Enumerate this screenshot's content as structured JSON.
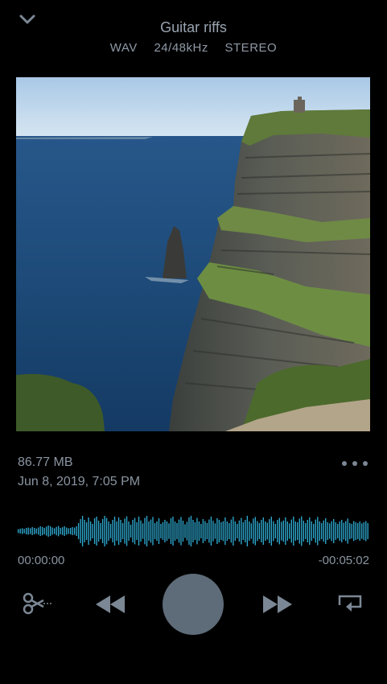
{
  "track": {
    "title": "Guitar riffs",
    "format": [
      "WAV",
      "24/48kHz",
      "STEREO"
    ]
  },
  "file": {
    "size": "86.77 MB",
    "date": "Jun 8, 2019, 7:05 PM"
  },
  "playback": {
    "elapsed": "00:00:00",
    "remaining": "-00:05:02"
  },
  "colors": {
    "background": "#000000",
    "text": "#8a95a1",
    "waveform": "#2ea8cf",
    "play_button": "#5e6b78"
  },
  "waveform_levels": [
    0.12,
    0.15,
    0.18,
    0.14,
    0.2,
    0.22,
    0.18,
    0.25,
    0.2,
    0.16,
    0.22,
    0.3,
    0.26,
    0.2,
    0.28,
    0.35,
    0.3,
    0.22,
    0.18,
    0.26,
    0.32,
    0.2,
    0.24,
    0.3,
    0.22,
    0.18,
    0.2,
    0.25,
    0.22,
    0.3,
    0.5,
    0.75,
    0.95,
    0.7,
    0.55,
    0.85,
    0.6,
    0.45,
    0.8,
    0.9,
    0.65,
    0.5,
    0.75,
    0.95,
    0.82,
    0.6,
    0.45,
    0.7,
    0.9,
    0.6,
    0.85,
    0.7,
    0.5,
    0.78,
    0.92,
    0.6,
    0.4,
    0.7,
    0.82,
    0.55,
    0.9,
    0.66,
    0.48,
    0.82,
    0.95,
    0.6,
    0.72,
    0.88,
    0.5,
    0.6,
    0.8,
    0.45,
    0.55,
    0.7,
    0.6,
    0.48,
    0.8,
    0.9,
    0.6,
    0.5,
    0.72,
    0.88,
    0.65,
    0.42,
    0.58,
    0.85,
    0.95,
    0.7,
    0.55,
    0.82,
    0.6,
    0.45,
    0.75,
    0.62,
    0.5,
    0.72,
    0.9,
    0.64,
    0.48,
    0.8,
    0.7,
    0.55,
    0.62,
    0.85,
    0.6,
    0.5,
    0.72,
    0.9,
    0.6,
    0.45,
    0.66,
    0.82,
    0.55,
    0.7,
    0.95,
    0.6,
    0.48,
    0.78,
    0.88,
    0.62,
    0.5,
    0.7,
    0.85,
    0.6,
    0.52,
    0.75,
    0.9,
    0.62,
    0.45,
    0.7,
    0.82,
    0.58,
    0.66,
    0.85,
    0.6,
    0.48,
    0.72,
    0.9,
    0.6,
    0.55,
    0.78,
    0.92,
    0.65,
    0.5,
    0.7,
    0.85,
    0.6,
    0.45,
    0.72,
    0.88,
    0.6,
    0.5,
    0.66,
    0.8,
    0.55,
    0.48,
    0.62,
    0.75,
    0.55,
    0.45,
    0.6,
    0.7,
    0.52,
    0.62,
    0.78,
    0.5,
    0.45,
    0.62,
    0.55,
    0.5,
    0.6,
    0.48,
    0.55,
    0.62,
    0.5
  ]
}
